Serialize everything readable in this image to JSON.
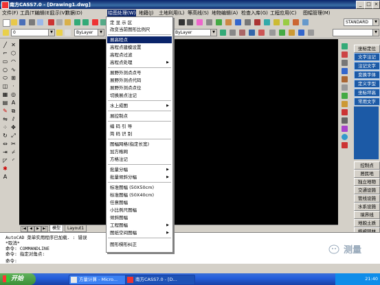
{
  "window": {
    "title": "南方CASS7.0 - [Drawing1.dwg]",
    "min": "_",
    "max": "□",
    "close": "×"
  },
  "menubar": [
    "文件(F)",
    "工具(T)",
    "编辑(E)",
    "显示(V)",
    "数据(D)",
    "绘图处理(W)",
    "地籍(J)",
    "土地利用(L)",
    "等高线(S)",
    "地物编辑(A)",
    "检查入库(G)",
    "工程应用(C)",
    "图幅管理(M)"
  ],
  "toolbar": {
    "layer_value": "0",
    "style_value": "STANDARD",
    "color_value": "ByLayer",
    "linetype_value": "ByLayer"
  },
  "dropdown": {
    "items": [
      {
        "label": "定 显 示 区",
        "sub": false
      },
      {
        "label": "改变当前图形比例尺",
        "sub": false
      },
      {
        "label": "展高程点",
        "sub": false,
        "highlighted": true
      },
      {
        "label": "高程点建模设置",
        "sub": false
      },
      {
        "label": "高程点过滤",
        "sub": false
      },
      {
        "label": "高程点处理",
        "sub": true
      },
      {
        "label": "展野外测点点号",
        "sub": false
      },
      {
        "label": "展野外测点代码",
        "sub": false
      },
      {
        "label": "展野外测点点位",
        "sub": false
      },
      {
        "label": "切换展点注记",
        "sub": false
      },
      {
        "label": "水上成图",
        "sub": true
      },
      {
        "label": "展控制点",
        "sub": false
      },
      {
        "label": "编 码 引 导",
        "sub": false
      },
      {
        "label": "简 码 识 别",
        "sub": false
      },
      {
        "label": "图幅网格(指定长宽)",
        "sub": false
      },
      {
        "label": "加方格网",
        "sub": false
      },
      {
        "label": "方格注记",
        "sub": false
      },
      {
        "label": "批量分幅",
        "sub": true
      },
      {
        "label": "批量倾斜分幅",
        "sub": true
      },
      {
        "label": "标准图幅 (50X50cm)",
        "sub": false
      },
      {
        "label": "标准图幅 (50X40cm)",
        "sub": false
      },
      {
        "label": "任意图幅",
        "sub": false
      },
      {
        "label": "小比例尺图幅",
        "sub": false
      },
      {
        "label": "倾斜图幅",
        "sub": false
      },
      {
        "label": "工程图幅",
        "sub": true
      },
      {
        "label": "图纸空间图幅",
        "sub": true
      },
      {
        "label": "图形梯形纠正",
        "sub": false
      }
    ]
  },
  "right_panel_top": [
    "坐标定位",
    "文字注记",
    "注记文字",
    "变换字体",
    "定义字型",
    "坐标坪高",
    "常用文字"
  ],
  "right_panel_bottom": [
    "控制点",
    "居民地",
    "独立地物",
    "交通设施",
    "管线设施",
    "水系设施",
    "境界线",
    "地貌土质",
    "植被园林"
  ],
  "tabs": [
    "模型",
    "Layout1"
  ],
  "command_lines": [
    "AutoCAD 菜单实用程序已加载. : 错误",
    "*取消*",
    "命令: COMMANDLINE",
    "命令: 指定对角点:",
    "命令:"
  ],
  "taskbar": {
    "start": "开始",
    "tasks": [
      "方量计算 - Micro...",
      "南方CASS7.0 - [D..."
    ],
    "clock": "21:40"
  },
  "watermark": "测量",
  "colors": {
    "accent": "#0a246a",
    "panel_blue": "#1c5aa6",
    "taskbar": "#245edc"
  }
}
